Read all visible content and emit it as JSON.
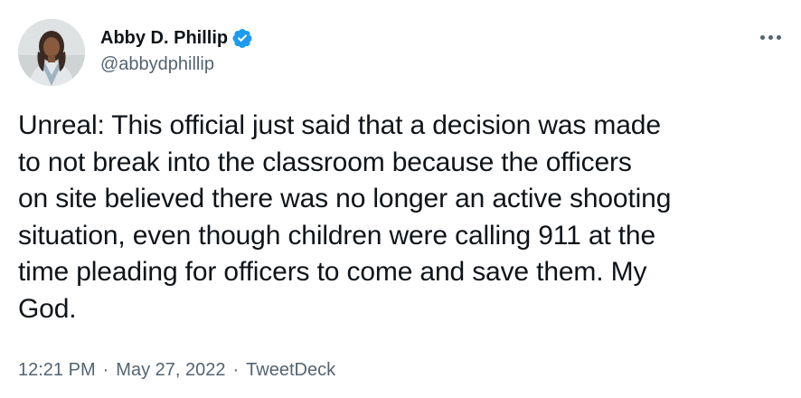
{
  "author": {
    "display_name": "Abby D. Phillip",
    "handle": "@abbydphillip",
    "verified": true,
    "verified_color": "#1d9bf0",
    "avatar_icon": "profile-photo"
  },
  "tweet": {
    "text": "Unreal: This official just said that a decision was made\nto not break into the classroom because the officers\non site believed there was no longer an active shooting\nsituation, even though children were calling 911 at the\ntime pleading for officers to come and save them. My\nGod."
  },
  "meta": {
    "time": "12:21 PM",
    "separator": "·",
    "date": "May 27, 2022",
    "source": "TweetDeck"
  },
  "actions": {
    "more_icon": "more-horizontal-icon"
  },
  "colors": {
    "text_primary": "#0f1419",
    "text_secondary": "#536471",
    "background": "#ffffff"
  }
}
